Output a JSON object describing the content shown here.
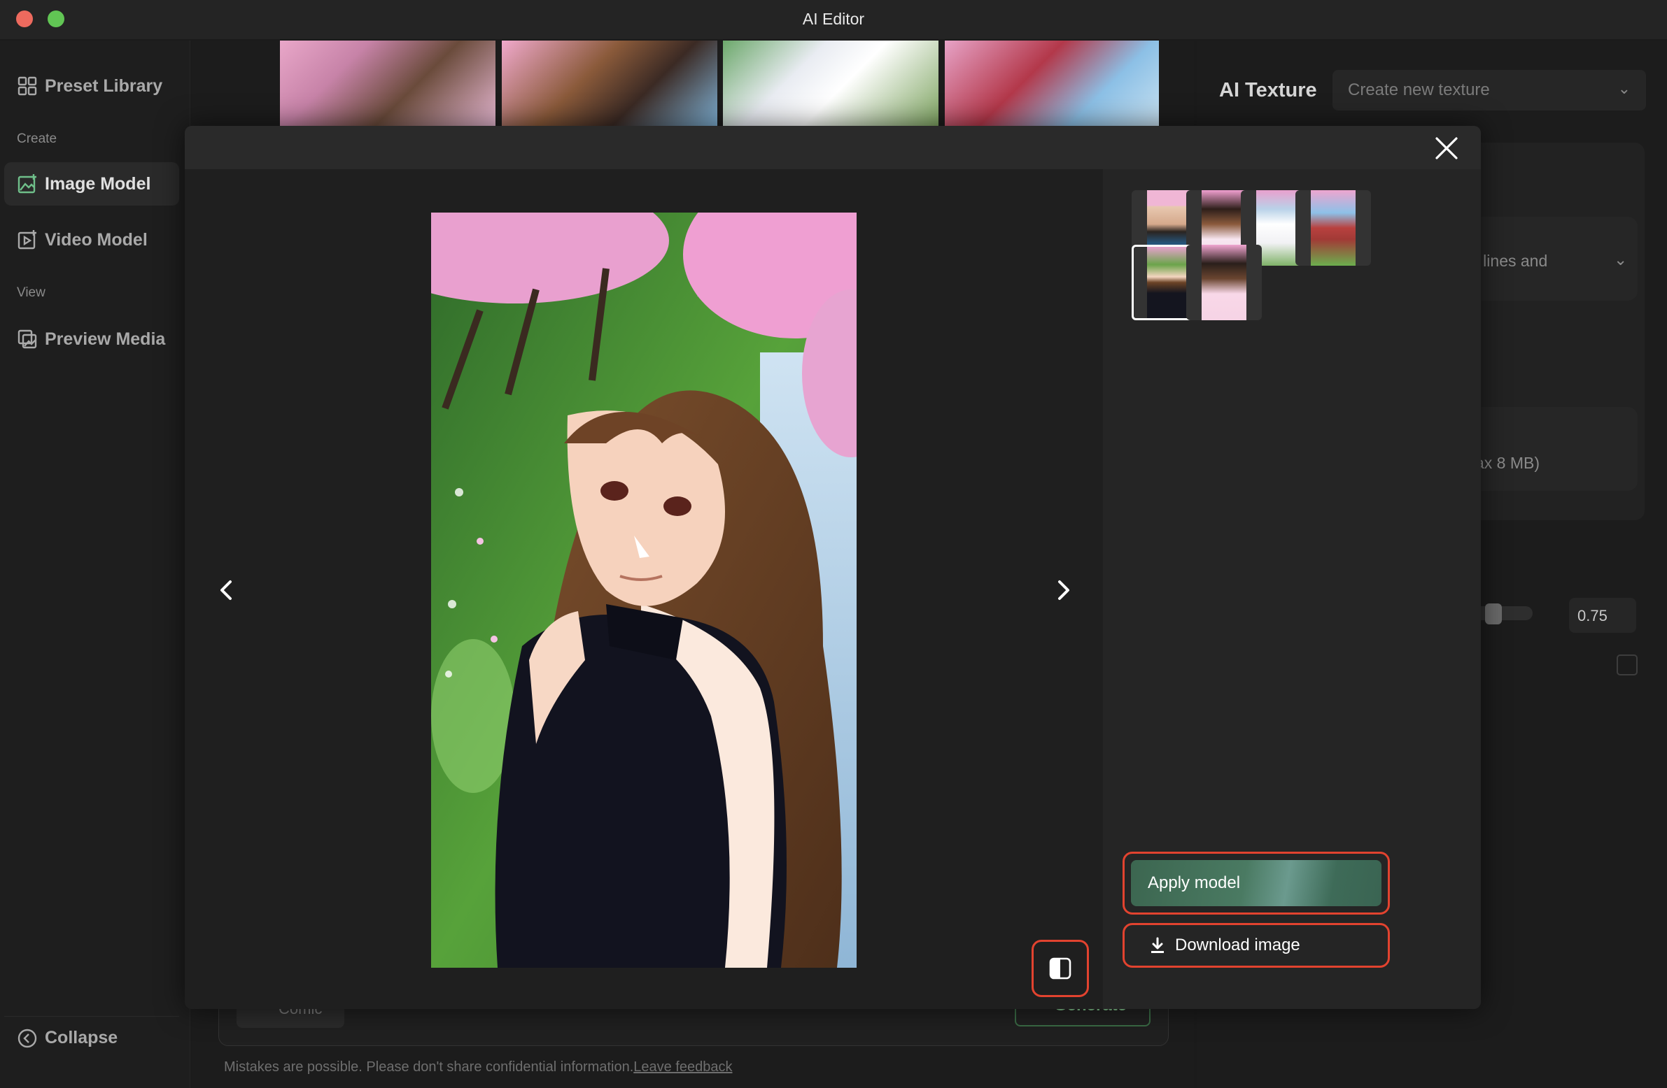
{
  "window": {
    "title": "AI Editor"
  },
  "sidebar": {
    "preset_library": "Preset Library",
    "section_create": "Create",
    "image_model": "Image Model",
    "video_model": "Video Model",
    "section_view": "View",
    "preview_media": "Preview Media",
    "collapse": "Collapse"
  },
  "composer": {
    "chip_label": "Comic",
    "generate_label": "Generate",
    "disclaimer": "Mistakes are possible. Please don't share confidential information.",
    "feedback_link": "Leave feedback"
  },
  "right_panel": {
    "title": "AI Texture",
    "texture_select": "Create new texture",
    "fragment_1": "n lines and",
    "fragment_2": "ax 8 MB)",
    "strength_value": "0.75"
  },
  "modal": {
    "thumbnail_count": 6,
    "selected_thumbnail": 5,
    "apply_label": "Apply model",
    "download_label": "Download image"
  },
  "colors": {
    "highlight": "#e2432f",
    "apply_button": "#4a7a62",
    "background": "#1b1b1b"
  }
}
